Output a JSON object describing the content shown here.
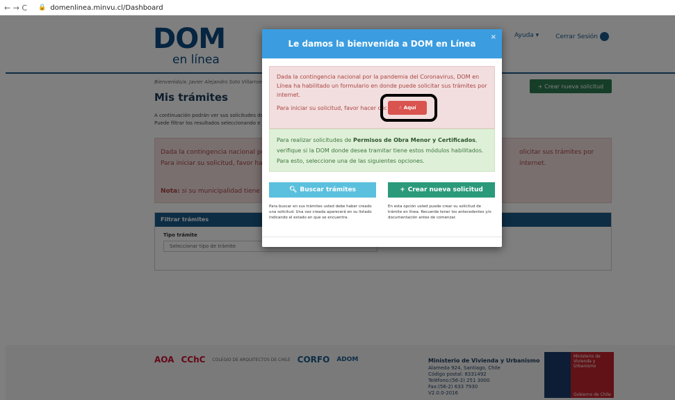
{
  "browser": {
    "nav": "← → C",
    "lock": "🔒",
    "url": "domenlinea.minvu.cl/Dashboard"
  },
  "header": {
    "logo_main": "DOM",
    "logo_sub": "en línea",
    "nav_help": "Ayuda ▾",
    "nav_logout": "Cerrar Sesión"
  },
  "page": {
    "welcome": "Bienvenido/a: Javier Alejandro Soto Villarroel",
    "title": "Mis trámites",
    "intro_line1": "A continuación podrán ver sus solicitudes de",
    "intro_line2": "Puede filtrar los resultados seleccionando e",
    "new_request_button": "+ Crear nueva solicitud",
    "alert_line1": "Dada la contingencia nacional por la",
    "alert_line2": "Para iniciar su solicitud, favor hacer",
    "alert_right": "olicitar sus trámites por internet.",
    "alert_note": "Nota:",
    "alert_note_text": "si su municipalidad tiene conv",
    "filter_header": "Filtrar trámites",
    "filter_label": "Tipo trámite",
    "filter_placeholder": "Seleccionar tipo de trámite"
  },
  "footer": {
    "logo_aoa": "AOA",
    "logo_cchc": "CChC",
    "logo_colegio": "COLEGIO DE ARQUITECTOS DE CHILE",
    "logo_corfo": "CORFO",
    "logo_adom": "ADOM",
    "ministry_title": "Ministerio de Vivienda y Urbanismo",
    "ministry_addr": "Alameda 924, Santiago, Chile",
    "ministry_postal": "Código postal: 8331492",
    "ministry_phone": "Teléfono:(56-2) 251 3000",
    "ministry_fax": "Fax:(56-2) 633 7930",
    "ministry_version": "V2.0.0-2016",
    "gov_label": "Ministerio de Vivienda y Urbanismo",
    "gov_bottom": "Gobierno de Chile"
  },
  "modal": {
    "title": "Le damos la bienvenida a DOM en Línea",
    "close": "×",
    "red_text": "Dada la contingencia nacional por la pandemia del Coronavirus, DOM en Línea ha habilitado un formulario en donde puede solicitar sus trámites por internet.",
    "red_text2": "Para iniciar su solicitud, favor hacer clic",
    "aqui_button": "Aquí",
    "green_pre": "Para realizar solicitudes de ",
    "green_bold": "Permisos de Obra Menor y Certificados",
    "green_post": ", verifique si la DOM donde desea tramitar tiene estos módulos habilitados. Para esto, seleccione una de las siguientes opciones.",
    "buscar_button": "Buscar trámites",
    "crear_button": "Crear nueva solicitud",
    "buscar_desc": "Para buscar en sus trámites usted debe haber creado una solicitud. Una vez creada aparecerá en su listado indicando el estado en que se encuentra.",
    "crear_desc": "En esta opción usted puede crear su solicitud de trámite en línea. Recuerde tener los antecedentes y/o documentación antes de comenzar."
  }
}
